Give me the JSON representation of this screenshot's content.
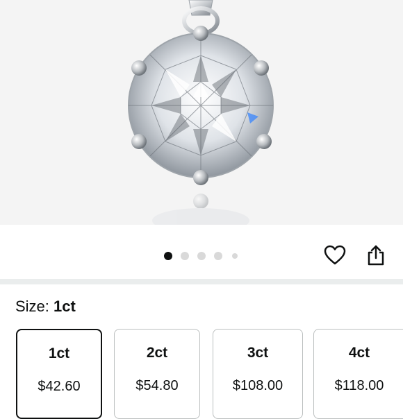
{
  "gallery": {
    "dot_count": 5,
    "active_index": 0
  },
  "actions": {
    "wishlist_icon": "heart-icon",
    "share_icon": "share-icon"
  },
  "size": {
    "label": "Size:",
    "selected": "1ct",
    "options": [
      {
        "name": "1ct",
        "price": "$42.60",
        "selected": true
      },
      {
        "name": "2ct",
        "price": "$54.80",
        "selected": false
      },
      {
        "name": "3ct",
        "price": "$108.00",
        "selected": false
      },
      {
        "name": "4ct",
        "price": "$118.00",
        "selected": false
      }
    ]
  },
  "colors": {
    "text": "#0f1111",
    "selected_border": "#0f1111",
    "unselected_border": "#bbbfbf",
    "active_dot": "#0f1111",
    "inactive_dot": "#d9d9d9",
    "divider": "#eaeded"
  }
}
